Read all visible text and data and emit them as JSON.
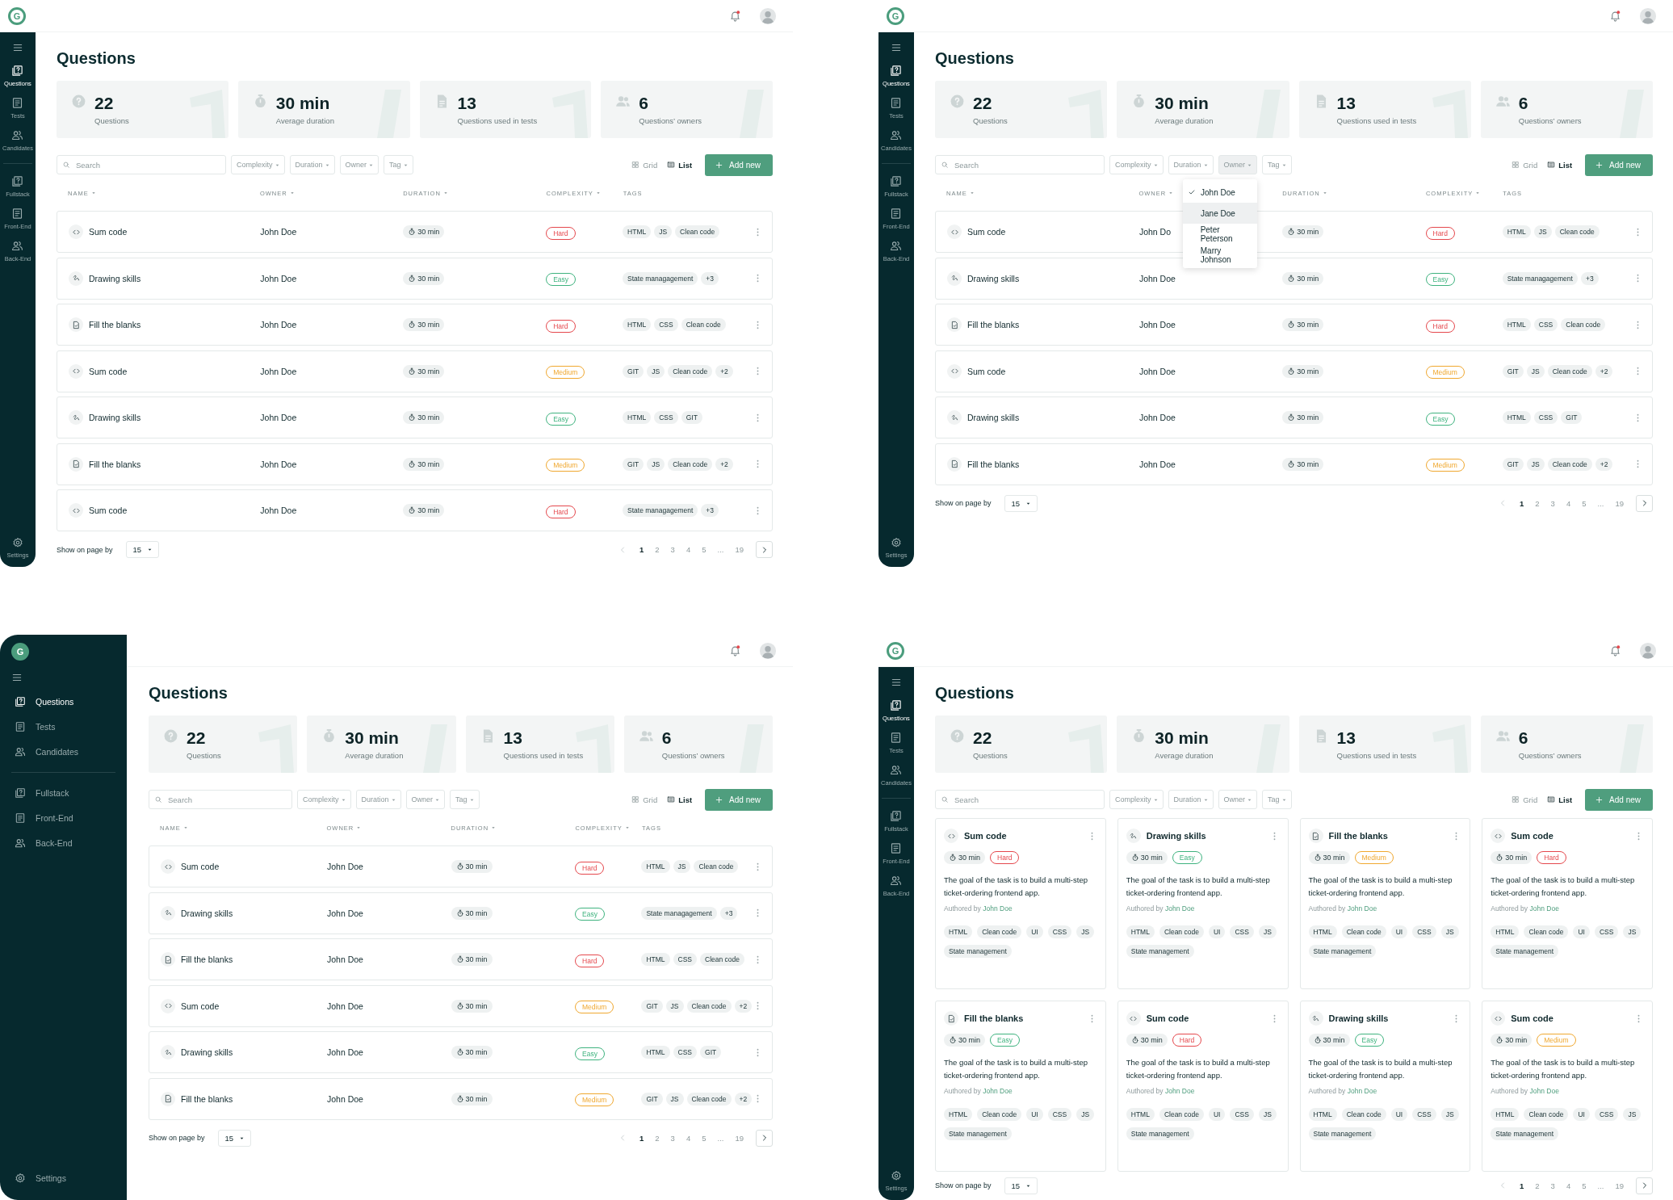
{
  "screens": [
    {
      "header": {
        "logo": "G"
      },
      "sidebar": {
        "expanded": false,
        "groups": [
          {
            "items": [
              {
                "label": "Questions",
                "kind": "question",
                "selected": true
              },
              {
                "label": "Tests",
                "kind": "document",
                "selected": false
              },
              {
                "label": "Candidates",
                "kind": "people",
                "selected": false
              }
            ]
          },
          {
            "items": [
              {
                "label": "Fullstack",
                "kind": "question",
                "selected": false
              },
              {
                "label": "Front-End",
                "kind": "document",
                "selected": false
              },
              {
                "label": "Back-End",
                "kind": "people",
                "selected": false
              }
            ]
          }
        ],
        "settings": "Settings"
      },
      "title": "Questions",
      "stats": [
        {
          "kind": "question",
          "value": "22",
          "label": "Questions"
        },
        {
          "kind": "timer",
          "value": "30 min",
          "label": "Average duration"
        },
        {
          "kind": "document",
          "value": "13",
          "label": "Questions used in tests"
        },
        {
          "kind": "people",
          "value": "6",
          "label": "Questions’ owners"
        }
      ],
      "toolbar": {
        "search_placeholder": "Search",
        "filters": [
          {
            "label": "Complexity",
            "open": false
          },
          {
            "label": "Duration",
            "open": false
          },
          {
            "label": "Owner",
            "open": false
          },
          {
            "label": "Tag",
            "open": false
          }
        ],
        "views": [
          {
            "kind": "grid",
            "label": "Grid",
            "selected": false
          },
          {
            "kind": "list",
            "label": "List",
            "selected": true
          }
        ],
        "add_button": "Add new"
      },
      "columns": [
        {
          "label": "NAME",
          "sortable": true
        },
        {
          "label": "OWNER",
          "sortable": true
        },
        {
          "label": "DURATION",
          "sortable": true
        },
        {
          "label": "COMPLEXITY",
          "sortable": true
        },
        {
          "label": "TAGS",
          "sortable": false
        }
      ],
      "rows": [
        {
          "kind": "code",
          "name": "Sum code",
          "owner": "John Doe",
          "duration": "30 min",
          "complexity": {
            "label": "Hard",
            "color": "#e5484d"
          },
          "tags": [
            "HTML",
            "JS",
            "Clean code"
          ]
        },
        {
          "kind": "drawing",
          "name": "Drawing skills",
          "owner": "John Doe",
          "duration": "30 min",
          "complexity": {
            "label": "Easy",
            "color": "#3fb37f"
          },
          "tags": [
            "State managagement",
            "+3"
          ]
        },
        {
          "kind": "blanks",
          "name": "Fill the blanks",
          "owner": "John Doe",
          "duration": "30 min",
          "complexity": {
            "label": "Hard",
            "color": "#e5484d"
          },
          "tags": [
            "HTML",
            "CSS",
            "Clean code"
          ]
        },
        {
          "kind": "code",
          "name": "Sum code",
          "owner": "John Doe",
          "duration": "30 min",
          "complexity": {
            "label": "Medium",
            "color": "#f0a830"
          },
          "tags": [
            "GIT",
            "JS",
            "Clean code",
            "+2"
          ]
        },
        {
          "kind": "drawing",
          "name": "Drawing skills",
          "owner": "John Doe",
          "duration": "30 min",
          "complexity": {
            "label": "Easy",
            "color": "#3fb37f"
          },
          "tags": [
            "HTML",
            "CSS",
            "GIT"
          ]
        },
        {
          "kind": "blanks",
          "name": "Fill the blanks",
          "owner": "John Doe",
          "duration": "30 min",
          "complexity": {
            "label": "Medium",
            "color": "#f0a830"
          },
          "tags": [
            "GIT",
            "JS",
            "Clean code",
            "+2"
          ]
        },
        {
          "kind": "code",
          "name": "Sum code",
          "owner": "John Doe",
          "duration": "30 min",
          "complexity": {
            "label": "Hard",
            "color": "#e5484d"
          },
          "tags": [
            "State managagement",
            "+3"
          ]
        }
      ],
      "pagination": {
        "label": "Show on page by",
        "page_size": "15",
        "pages": [
          {
            "label": "1",
            "selected": true
          },
          {
            "label": "2",
            "selected": false
          },
          {
            "label": "3",
            "selected": false
          },
          {
            "label": "4",
            "selected": false
          },
          {
            "label": "5",
            "selected": false
          },
          {
            "label": "...",
            "selected": false
          },
          {
            "label": "19",
            "selected": false
          }
        ]
      }
    },
    {
      "header": {
        "logo": "G"
      },
      "sidebar": {
        "expanded": false,
        "groups": [
          {
            "items": [
              {
                "label": "Questions",
                "kind": "question",
                "selected": true
              },
              {
                "label": "Tests",
                "kind": "document",
                "selected": false
              },
              {
                "label": "Candidates",
                "kind": "people",
                "selected": false
              }
            ]
          },
          {
            "items": [
              {
                "label": "Fullstack",
                "kind": "question",
                "selected": false
              },
              {
                "label": "Front-End",
                "kind": "document",
                "selected": false
              },
              {
                "label": "Back-End",
                "kind": "people",
                "selected": false
              }
            ]
          }
        ],
        "settings": "Settings"
      },
      "title": "Questions",
      "stats": [
        {
          "kind": "question",
          "value": "22",
          "label": "Questions"
        },
        {
          "kind": "timer",
          "value": "30 min",
          "label": "Average duration"
        },
        {
          "kind": "document",
          "value": "13",
          "label": "Questions used in tests"
        },
        {
          "kind": "people",
          "value": "6",
          "label": "Questions’ owners"
        }
      ],
      "toolbar": {
        "search_placeholder": "Search",
        "filters": [
          {
            "label": "Complexity",
            "open": false
          },
          {
            "label": "Duration",
            "open": false
          },
          {
            "label": "Owner",
            "open": true,
            "options": [
              {
                "label": "John Doe",
                "checked": true,
                "highlighted": false
              },
              {
                "label": "Jane Doe",
                "checked": false,
                "highlighted": true
              },
              {
                "label": "Peter Peterson",
                "checked": false,
                "highlighted": false
              },
              {
                "label": "Marry Johnson",
                "checked": false,
                "highlighted": false
              }
            ]
          },
          {
            "label": "Tag",
            "open": false
          }
        ],
        "views": [
          {
            "kind": "grid",
            "label": "Grid",
            "selected": false
          },
          {
            "kind": "list",
            "label": "List",
            "selected": true
          }
        ],
        "add_button": "Add new"
      },
      "columns": [
        {
          "label": "NAME",
          "sortable": true
        },
        {
          "label": "OWNER",
          "sortable": true
        },
        {
          "label": "DURATION",
          "sortable": true
        },
        {
          "label": "COMPLEXITY",
          "sortable": true
        },
        {
          "label": "TAGS",
          "sortable": false
        }
      ],
      "rows": [
        {
          "kind": "code",
          "name": "Sum code",
          "owner": "John Do",
          "duration": "30 min",
          "complexity": {
            "label": "Hard",
            "color": "#e5484d"
          },
          "tags": [
            "HTML",
            "JS",
            "Clean code"
          ]
        },
        {
          "kind": "drawing",
          "name": "Drawing skills",
          "owner": "John Doe",
          "duration": "30 min",
          "complexity": {
            "label": "Easy",
            "color": "#3fb37f"
          },
          "tags": [
            "State managagement",
            "+3"
          ]
        },
        {
          "kind": "blanks",
          "name": "Fill the blanks",
          "owner": "John Doe",
          "duration": "30 min",
          "complexity": {
            "label": "Hard",
            "color": "#e5484d"
          },
          "tags": [
            "HTML",
            "CSS",
            "Clean code"
          ]
        },
        {
          "kind": "code",
          "name": "Sum code",
          "owner": "John Doe",
          "duration": "30 min",
          "complexity": {
            "label": "Medium",
            "color": "#f0a830"
          },
          "tags": [
            "GIT",
            "JS",
            "Clean code",
            "+2"
          ]
        },
        {
          "kind": "drawing",
          "name": "Drawing skills",
          "owner": "John Doe",
          "duration": "30 min",
          "complexity": {
            "label": "Easy",
            "color": "#3fb37f"
          },
          "tags": [
            "HTML",
            "CSS",
            "GIT"
          ]
        },
        {
          "kind": "blanks",
          "name": "Fill the blanks",
          "owner": "John Doe",
          "duration": "30 min",
          "complexity": {
            "label": "Medium",
            "color": "#f0a830"
          },
          "tags": [
            "GIT",
            "JS",
            "Clean code",
            "+2"
          ]
        }
      ],
      "pagination": {
        "label": "Show on page by",
        "page_size": "15",
        "pages": [
          {
            "label": "1",
            "selected": true
          },
          {
            "label": "2",
            "selected": false
          },
          {
            "label": "3",
            "selected": false
          },
          {
            "label": "4",
            "selected": false
          },
          {
            "label": "5",
            "selected": false
          },
          {
            "label": "...",
            "selected": false
          },
          {
            "label": "19",
            "selected": false
          }
        ]
      }
    },
    {
      "header": {
        "logo": "G"
      },
      "sidebar": {
        "expanded": true,
        "groups": [
          {
            "items": [
              {
                "label": "Questions",
                "kind": "question",
                "selected": true
              },
              {
                "label": "Tests",
                "kind": "document",
                "selected": false
              },
              {
                "label": "Candidates",
                "kind": "people",
                "selected": false
              }
            ]
          },
          {
            "items": [
              {
                "label": "Fullstack",
                "kind": "question",
                "selected": false
              },
              {
                "label": "Front-End",
                "kind": "document",
                "selected": false
              },
              {
                "label": "Back-End",
                "kind": "people",
                "selected": false
              }
            ]
          }
        ],
        "settings": "Settings"
      },
      "title": "Questions",
      "stats": [
        {
          "kind": "question",
          "value": "22",
          "label": "Questions"
        },
        {
          "kind": "timer",
          "value": "30 min",
          "label": "Average duration"
        },
        {
          "kind": "document",
          "value": "13",
          "label": "Questions used in tests"
        },
        {
          "kind": "people",
          "value": "6",
          "label": "Questions’ owners"
        }
      ],
      "toolbar": {
        "search_placeholder": "Search",
        "filters": [
          {
            "label": "Complexity",
            "open": false
          },
          {
            "label": "Duration",
            "open": false
          },
          {
            "label": "Owner",
            "open": false
          },
          {
            "label": "Tag",
            "open": false
          }
        ],
        "views": [
          {
            "kind": "grid",
            "label": "Grid",
            "selected": false
          },
          {
            "kind": "list",
            "label": "List",
            "selected": true
          }
        ],
        "add_button": "Add new"
      },
      "columns": [
        {
          "label": "NAME",
          "sortable": true
        },
        {
          "label": "OWNER",
          "sortable": true
        },
        {
          "label": "DURATION",
          "sortable": true
        },
        {
          "label": "COMPLEXITY",
          "sortable": true
        },
        {
          "label": "TAGS",
          "sortable": false
        }
      ],
      "rows": [
        {
          "kind": "code",
          "name": "Sum code",
          "owner": "John Doe",
          "duration": "30 min",
          "complexity": {
            "label": "Hard",
            "color": "#e5484d"
          },
          "tags": [
            "HTML",
            "JS",
            "Clean code"
          ]
        },
        {
          "kind": "drawing",
          "name": "Drawing skills",
          "owner": "John Doe",
          "duration": "30 min",
          "complexity": {
            "label": "Easy",
            "color": "#3fb37f"
          },
          "tags": [
            "State managagement",
            "+3"
          ]
        },
        {
          "kind": "blanks",
          "name": "Fill the blanks",
          "owner": "John Doe",
          "duration": "30 min",
          "complexity": {
            "label": "Hard",
            "color": "#e5484d"
          },
          "tags": [
            "HTML",
            "CSS",
            "Clean code"
          ]
        },
        {
          "kind": "code",
          "name": "Sum code",
          "owner": "John Doe",
          "duration": "30 min",
          "complexity": {
            "label": "Medium",
            "color": "#f0a830"
          },
          "tags": [
            "GIT",
            "JS",
            "Clean code",
            "+2"
          ]
        },
        {
          "kind": "drawing",
          "name": "Drawing skills",
          "owner": "John Doe",
          "duration": "30 min",
          "complexity": {
            "label": "Easy",
            "color": "#3fb37f"
          },
          "tags": [
            "HTML",
            "CSS",
            "GIT"
          ]
        },
        {
          "kind": "blanks",
          "name": "Fill the blanks",
          "owner": "John Doe",
          "duration": "30 min",
          "complexity": {
            "label": "Medium",
            "color": "#f0a830"
          },
          "tags": [
            "GIT",
            "JS",
            "Clean code",
            "+2"
          ]
        }
      ],
      "pagination": {
        "label": "Show on page by",
        "page_size": "15",
        "pages": [
          {
            "label": "1",
            "selected": true
          },
          {
            "label": "2",
            "selected": false
          },
          {
            "label": "3",
            "selected": false
          },
          {
            "label": "4",
            "selected": false
          },
          {
            "label": "5",
            "selected": false
          },
          {
            "label": "...",
            "selected": false
          },
          {
            "label": "19",
            "selected": false
          }
        ]
      }
    },
    {
      "header": {
        "logo": "G"
      },
      "sidebar": {
        "expanded": false,
        "groups": [
          {
            "items": [
              {
                "label": "Questions",
                "kind": "question",
                "selected": true
              },
              {
                "label": "Tests",
                "kind": "document",
                "selected": false
              },
              {
                "label": "Candidates",
                "kind": "people",
                "selected": false
              }
            ]
          },
          {
            "items": [
              {
                "label": "Fullstack",
                "kind": "question",
                "selected": false
              },
              {
                "label": "Front-End",
                "kind": "document",
                "selected": false
              },
              {
                "label": "Back-End",
                "kind": "people",
                "selected": false
              }
            ]
          }
        ],
        "settings": "Settings"
      },
      "title": "Questions",
      "stats": [
        {
          "kind": "question",
          "value": "22",
          "label": "Questions"
        },
        {
          "kind": "timer",
          "value": "30 min",
          "label": "Average duration"
        },
        {
          "kind": "document",
          "value": "13",
          "label": "Questions used in tests"
        },
        {
          "kind": "people",
          "value": "6",
          "label": "Questions’ owners"
        }
      ],
      "toolbar": {
        "search_placeholder": "Search",
        "filters": [
          {
            "label": "Complexity",
            "open": false
          },
          {
            "label": "Duration",
            "open": false
          },
          {
            "label": "Owner",
            "open": false
          },
          {
            "label": "Tag",
            "open": false
          }
        ],
        "views": [
          {
            "kind": "grid",
            "label": "Grid",
            "selected": false
          },
          {
            "kind": "list",
            "label": "List",
            "selected": true
          }
        ],
        "add_button": "Add new"
      },
      "cards": [
        {
          "kind": "code",
          "name": "Sum code",
          "duration": "30 min",
          "complexity": {
            "label": "Hard",
            "color": "#e5484d"
          },
          "description": "The goal of the task is to build a multi-step ticket-ordering frontend app.",
          "author_prefix": "Authored by",
          "author": "John Doe",
          "tags": [
            "HTML",
            "Clean code",
            "UI",
            "CSS",
            "JS",
            "State management"
          ]
        },
        {
          "kind": "drawing",
          "name": "Drawing skills",
          "duration": "30 min",
          "complexity": {
            "label": "Easy",
            "color": "#3fb37f"
          },
          "description": "The goal of the task is to build a multi-step ticket-ordering frontend app.",
          "author_prefix": "Authored by",
          "author": "John Doe",
          "tags": [
            "HTML",
            "Clean code",
            "UI",
            "CSS",
            "JS",
            "State management"
          ]
        },
        {
          "kind": "blanks",
          "name": "Fill the blanks",
          "duration": "30 min",
          "complexity": {
            "label": "Medium",
            "color": "#f0a830"
          },
          "description": "The goal of the task is to build a multi-step ticket-ordering frontend app.",
          "author_prefix": "Authored by",
          "author": "John Doe",
          "tags": [
            "HTML",
            "Clean code",
            "UI",
            "CSS",
            "JS",
            "State management"
          ]
        },
        {
          "kind": "code",
          "name": "Sum code",
          "duration": "30 min",
          "complexity": {
            "label": "Hard",
            "color": "#e5484d"
          },
          "description": "The goal of the task is to build a multi-step ticket-ordering frontend app.",
          "author_prefix": "Authored by",
          "author": "John Doe",
          "tags": [
            "HTML",
            "Clean code",
            "UI",
            "CSS",
            "JS",
            "State management"
          ]
        },
        {
          "kind": "blanks",
          "name": "Fill the blanks",
          "duration": "30 min",
          "complexity": {
            "label": "Easy",
            "color": "#3fb37f"
          },
          "description": "The goal of the task is to build a multi-step ticket-ordering frontend app.",
          "author_prefix": "Authored by",
          "author": "John Doe",
          "tags": [
            "HTML",
            "Clean code",
            "UI",
            "CSS",
            "JS",
            "State management"
          ]
        },
        {
          "kind": "code",
          "name": "Sum code",
          "duration": "30 min",
          "complexity": {
            "label": "Hard",
            "color": "#e5484d"
          },
          "description": "The goal of the task is to build a multi-step ticket-ordering frontend app.",
          "author_prefix": "Authored by",
          "author": "John Doe",
          "tags": [
            "HTML",
            "Clean code",
            "UI",
            "CSS",
            "JS",
            "State management"
          ]
        },
        {
          "kind": "drawing",
          "name": "Drawing skills",
          "duration": "30 min",
          "complexity": {
            "label": "Easy",
            "color": "#3fb37f"
          },
          "description": "The goal of the task is to build a multi-step ticket-ordering frontend app.",
          "author_prefix": "Authored by",
          "author": "John Doe",
          "tags": [
            "HTML",
            "Clean code",
            "UI",
            "CSS",
            "JS",
            "State management"
          ]
        },
        {
          "kind": "code",
          "name": "Sum code",
          "duration": "30 min",
          "complexity": {
            "label": "Medium",
            "color": "#f0a830"
          },
          "description": "The goal of the task is to build a multi-step ticket-ordering frontend app.",
          "author_prefix": "Authored by",
          "author": "John Doe",
          "tags": [
            "HTML",
            "Clean code",
            "UI",
            "CSS",
            "JS",
            "State management"
          ]
        }
      ],
      "pagination": {
        "label": "Show on page by",
        "page_size": "15",
        "pages": [
          {
            "label": "1",
            "selected": true
          },
          {
            "label": "2",
            "selected": false
          },
          {
            "label": "3",
            "selected": false
          },
          {
            "label": "4",
            "selected": false
          },
          {
            "label": "5",
            "selected": false
          },
          {
            "label": "...",
            "selected": false
          },
          {
            "label": "19",
            "selected": false
          }
        ]
      }
    }
  ]
}
